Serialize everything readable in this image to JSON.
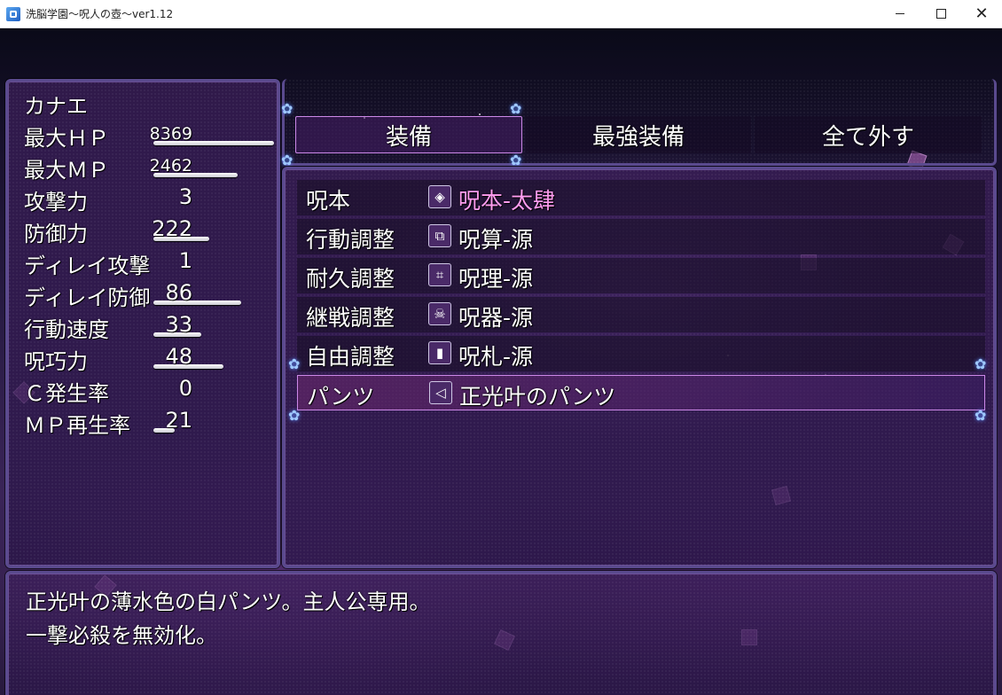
{
  "window": {
    "title": "洗脳学園～呪人の壺～ver1.12",
    "minimize_icon": "minimize-icon",
    "maximize_icon": "maximize-icon",
    "close_icon": "close-icon",
    "close_glyph": "✕"
  },
  "status": {
    "name": "カナエ",
    "rows": [
      {
        "label": "最大ＨＰ",
        "value": "8369",
        "bar": 1.0
      },
      {
        "label": "最大ＭＰ",
        "value": "2462",
        "bar": 0.7
      },
      {
        "label": "攻撃力",
        "value": "3",
        "bar": 0.0
      },
      {
        "label": "防御力",
        "value": "222",
        "bar": 0.46
      },
      {
        "label": "ディレイ攻撃",
        "value": "1",
        "bar": 0.0
      },
      {
        "label": "ディレイ防御",
        "value": "86",
        "bar": 0.73
      },
      {
        "label": "行動速度",
        "value": "33",
        "bar": 0.4
      },
      {
        "label": "呪巧力",
        "value": "48",
        "bar": 0.58
      },
      {
        "label": "Ｃ発生率",
        "value": "0",
        "bar": 0.0
      },
      {
        "label": "ＭＰ再生率",
        "value": "21",
        "bar": 0.18
      }
    ]
  },
  "commands": {
    "equip": "装備",
    "optimize": "最強装備",
    "clear": "全て外す",
    "selected": "equip"
  },
  "slots": [
    {
      "label": "呪本",
      "icon": "spell-book-icon",
      "glyph": "◈",
      "item": "呪本-太肆",
      "color": "#ff9cf0"
    },
    {
      "label": "行動調整",
      "icon": "overlap-squares-icon",
      "glyph": "⧉",
      "item": "呪算-源"
    },
    {
      "label": "耐久調整",
      "icon": "circuit-icon",
      "glyph": "⌗",
      "item": "呪理-源"
    },
    {
      "label": "継戦調整",
      "icon": "skeleton-icon",
      "glyph": "☠",
      "item": "呪器-源"
    },
    {
      "label": "自由調整",
      "icon": "talisman-icon",
      "glyph": "▮",
      "item": "呪札-源"
    },
    {
      "label": "パンツ",
      "icon": "panties-icon",
      "glyph": "◁",
      "item": "正光叶のパンツ",
      "selected": true
    }
  ],
  "help": {
    "line1": "正光叶の薄水色の白パンツ。主人公専用。",
    "line2": "一撃必殺を無効化。"
  },
  "colors": {
    "accent": "#cc88e8",
    "frame": "#5a4a8e",
    "highlight_item": "#ff9cf0"
  }
}
